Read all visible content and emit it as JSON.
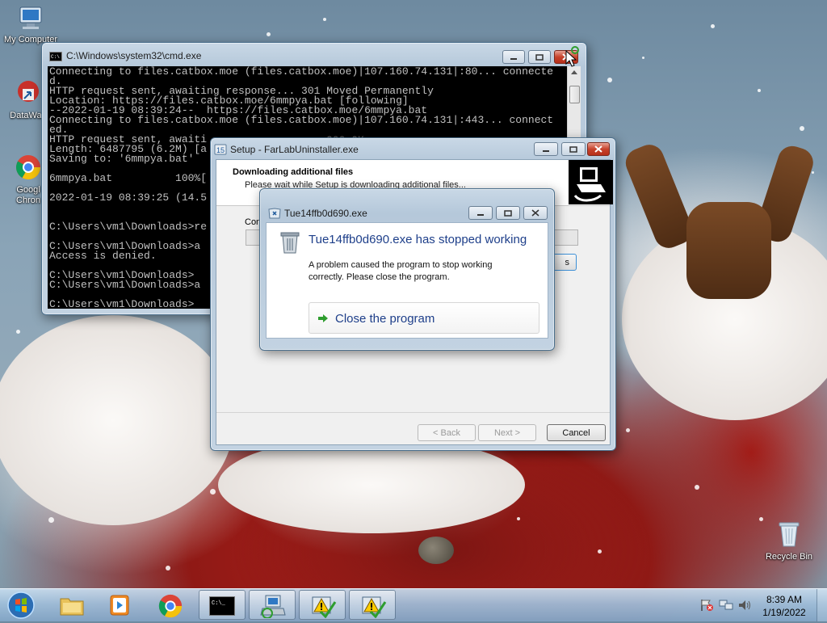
{
  "desktop": {
    "icons": [
      {
        "label": "My Computer"
      },
      {
        "label": "DataWag"
      },
      {
        "label": "Googl Chron"
      },
      {
        "label": "Recycle Bin"
      }
    ]
  },
  "cmd": {
    "title": "C:\\Windows\\system32\\cmd.exe",
    "lines": [
      "Connecting to files.catbox.moe (files.catbox.moe)|107.160.74.131|:80... connecte",
      "d.",
      "HTTP request sent, awaiting response... 301 Moved Permanently",
      "Location: https://files.catbox.moe/6mmpya.bat [following]",
      "--2022-01-19 08:39:24--  https://files.catbox.moe/6mmpya.bat",
      "Connecting to files.catbox.moe (files.catbox.moe)|107.160.74.131|:443... connect",
      "ed.",
      "HTTP request sent, awaiti",
      "Length: 6487795 (6.2M) [a",
      "Saving to: '6mmpya.bat'",
      "",
      "6mmpya.bat          100%[",
      "",
      "2022-01-19 08:39:25 (14.5",
      "",
      "",
      "C:\\Users\\vm1\\Downloads>re",
      "",
      "C:\\Users\\vm1\\Downloads>a",
      "Access is denied.",
      "",
      "C:\\Users\\vm1\\Downloads>",
      "C:\\Users\\vm1\\Downloads>a",
      "",
      "C:\\Users\\vm1\\Downloads>"
    ],
    "partial_right": "200 OK"
  },
  "setup": {
    "title": "Setup - FarLabUninstaller.exe",
    "heading": "Downloading additional files",
    "subheading": "Please wait while Setup is downloading additional files...",
    "partial_label": "Con",
    "partial_button": "s",
    "back_label": "< Back",
    "next_label": "Next >",
    "cancel_label": "Cancel"
  },
  "error_dialog": {
    "title": "Tue14ffb0d690.exe",
    "heading": "Tue14ffb0d690.exe has stopped working",
    "message": "A problem caused the program to stop working correctly. Please close the program.",
    "action_label": "Close the program"
  },
  "taskbar": {
    "time": "8:39 AM",
    "date": "1/19/2022",
    "items": [
      "start-orb",
      "explorer",
      "media-player",
      "chrome",
      "cmd",
      "setup",
      "uninstaller-1",
      "uninstaller-2"
    ]
  },
  "colors": {
    "accent_blue": "#1e5a9c",
    "close_red": "#c7432c",
    "arrow_green": "#2e9d2e"
  }
}
